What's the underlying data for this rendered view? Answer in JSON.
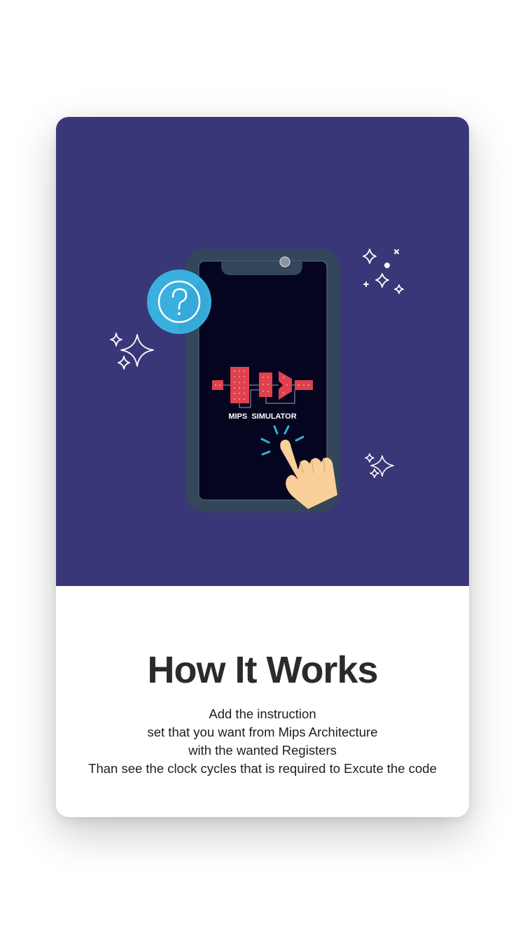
{
  "onboarding": {
    "title": "How It Works",
    "description_lines": [
      "Add the instruction",
      "set that you want from Mips Architecture",
      "with the wanted Registers",
      "Than see the clock cycles that is required to Excute the code"
    ]
  },
  "illustration": {
    "phone_screen_label": "MIPS  SIMULATOR",
    "badge_icon": "question-mark-icon",
    "hand_icon": "tapping-hand-icon",
    "decorations": [
      "sparkle-icon"
    ]
  },
  "colors": {
    "hero_background": "#3a3779",
    "phone_frame": "#33465a",
    "phone_screen": "#05051f",
    "badge_blue": "#3ab0de",
    "chip_red": "#e0414f",
    "tap_lines": "#2fb3d6",
    "skin": "#f9cf9a",
    "title_text": "#2b2b2b",
    "body_text": "#1e1e1e"
  }
}
